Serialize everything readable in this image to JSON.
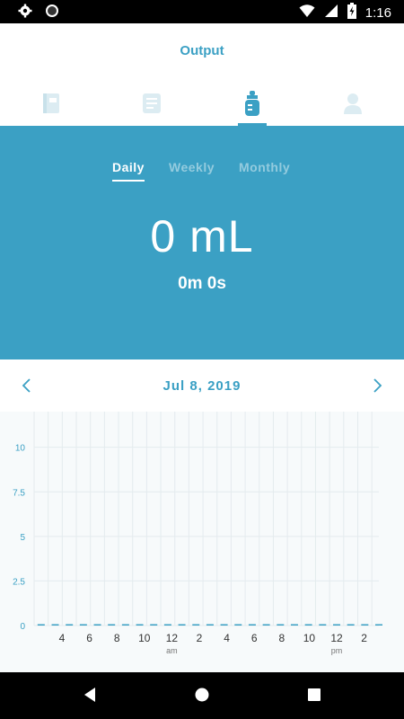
{
  "status_bar": {
    "time": "1:16",
    "icons": [
      "gear-icon",
      "circle-icon",
      "wifi-icon",
      "signal-icon",
      "battery-charging-icon"
    ]
  },
  "header": {
    "title": "Output",
    "tabs": [
      {
        "name": "journal-icon",
        "active": false
      },
      {
        "name": "notes-icon",
        "active": false
      },
      {
        "name": "bottle-icon",
        "active": true
      },
      {
        "name": "profile-icon",
        "active": false
      }
    ]
  },
  "summary": {
    "periods": [
      "Daily",
      "Weekly",
      "Monthly"
    ],
    "active_period": "Daily",
    "total_amount": "0 mL",
    "total_time": "0m 0s"
  },
  "date_nav": {
    "date": "Jul 8, 2019",
    "prev_icon": "chevron-left-icon",
    "next_icon": "chevron-right-icon"
  },
  "colors": {
    "accent": "#3ba0c4",
    "grid": "#e4ebee",
    "axis_text": "#3ba0c4"
  },
  "chart_data": {
    "type": "bar",
    "y_ticks": [
      "0",
      "2.5",
      "5",
      "7.5",
      "10"
    ],
    "ylim": [
      0,
      12
    ],
    "x_tick_labels": [
      "4",
      "6",
      "8",
      "10",
      "12",
      "2",
      "4",
      "6",
      "8",
      "10",
      "12",
      "2"
    ],
    "x_sub_labels": [
      {
        "label": "am",
        "under_tick_index": 4
      },
      {
        "label": "pm",
        "under_tick_index": 10
      }
    ],
    "values": [
      0,
      0,
      0,
      0,
      0,
      0,
      0,
      0,
      0,
      0,
      0,
      0,
      0,
      0,
      0,
      0,
      0,
      0,
      0,
      0,
      0,
      0,
      0,
      0,
      0
    ],
    "grid": true
  }
}
